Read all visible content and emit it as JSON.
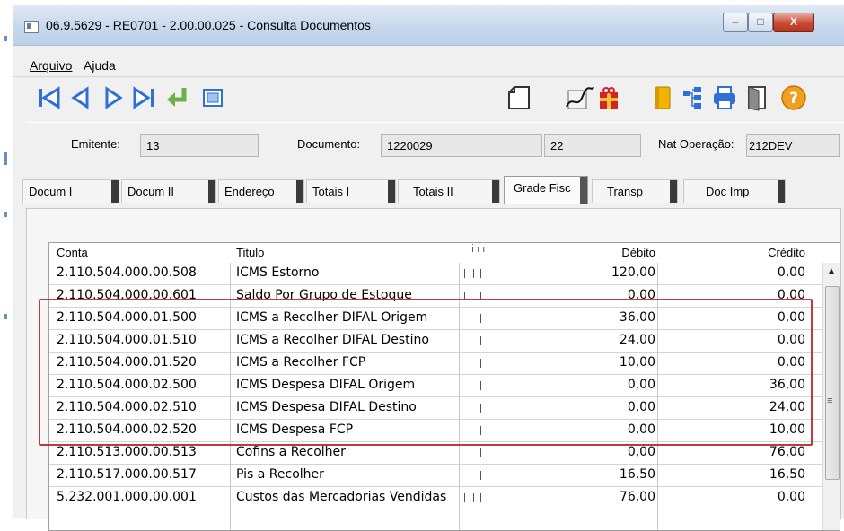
{
  "window": {
    "title": "06.9.5629 - RE0701 - 2.00.00.025 - Consulta Documentos",
    "controls": {
      "minimize": "–",
      "maximize": "□",
      "close": "X"
    }
  },
  "menu": {
    "items": [
      "Arquivo",
      "Ajuda"
    ]
  },
  "toolbar": {
    "icons": [
      "first-icon",
      "prev-icon",
      "next-icon",
      "last-icon",
      "enter-icon",
      "zoom-icon",
      "new-page-icon",
      "signature-icon",
      "gift-icon",
      "book-icon",
      "tree-icon",
      "printer-icon",
      "exit-door-icon",
      "help-icon"
    ],
    "colors": {
      "nav_blue": "#2f6fd6",
      "enter_green": "#6ab04c",
      "help_orange": "#f0a020"
    }
  },
  "header": {
    "emitente_label": "Emitente:",
    "emitente_value": "13",
    "documento_label": "Documento:",
    "documento_value": "1220029",
    "serie_value": "22",
    "nat_label": "Nat Operação:",
    "nat_value": "212DEV"
  },
  "tabs": [
    {
      "label": "Docum I"
    },
    {
      "label": "Docum II"
    },
    {
      "label": "Endereço"
    },
    {
      "label": "Totais I"
    },
    {
      "label": "Totais II"
    },
    {
      "label": "Grade Fisc",
      "active": true
    },
    {
      "label": "Transp"
    },
    {
      "label": "Doc Imp"
    }
  ],
  "grid": {
    "columns": {
      "conta": "Conta",
      "titulo": "Titulo",
      "debito": "Débito",
      "credito": "Crédito"
    },
    "rows": [
      {
        "conta": "2.110.504.000.00.508",
        "titulo": "ICMS Estorno",
        "debito": "120,00",
        "credito": "0,00"
      },
      {
        "conta": "2.110.504.000.00.601",
        "titulo": "Saldo Por Grupo de Estoque",
        "debito": "0,00",
        "credito": "0,00"
      },
      {
        "conta": "2.110.504.000.01.500",
        "titulo": "ICMS a Recolher DIFAL Origem",
        "debito": "36,00",
        "credito": "0,00"
      },
      {
        "conta": "2.110.504.000.01.510",
        "titulo": "ICMS a Recolher DIFAL Destino",
        "debito": "24,00",
        "credito": "0,00"
      },
      {
        "conta": "2.110.504.000.01.520",
        "titulo": "ICMS a Recolher FCP",
        "debito": "10,00",
        "credito": "0,00"
      },
      {
        "conta": "2.110.504.000.02.500",
        "titulo": "ICMS Despesa DIFAL Origem",
        "debito": "0,00",
        "credito": "36,00"
      },
      {
        "conta": "2.110.504.000.02.510",
        "titulo": "ICMS Despesa DIFAL Destino",
        "debito": "0,00",
        "credito": "24,00"
      },
      {
        "conta": "2.110.504.000.02.520",
        "titulo": "ICMS Despesa FCP",
        "debito": "0,00",
        "credito": "10,00"
      },
      {
        "conta": "2.110.513.000.00.513",
        "titulo": "Cofins a Recolher",
        "debito": "0,00",
        "credito": "76,00"
      },
      {
        "conta": "2.110.517.000.00.517",
        "titulo": "Pis a Recolher",
        "debito": "16,50",
        "credito": "16,50"
      },
      {
        "conta": "5.232.001.000.00.001",
        "titulo": "Custos das Mercadorias Vendidas",
        "debito": "76,00",
        "credito": "0,00"
      }
    ],
    "highlight_color": "#c0393b"
  }
}
